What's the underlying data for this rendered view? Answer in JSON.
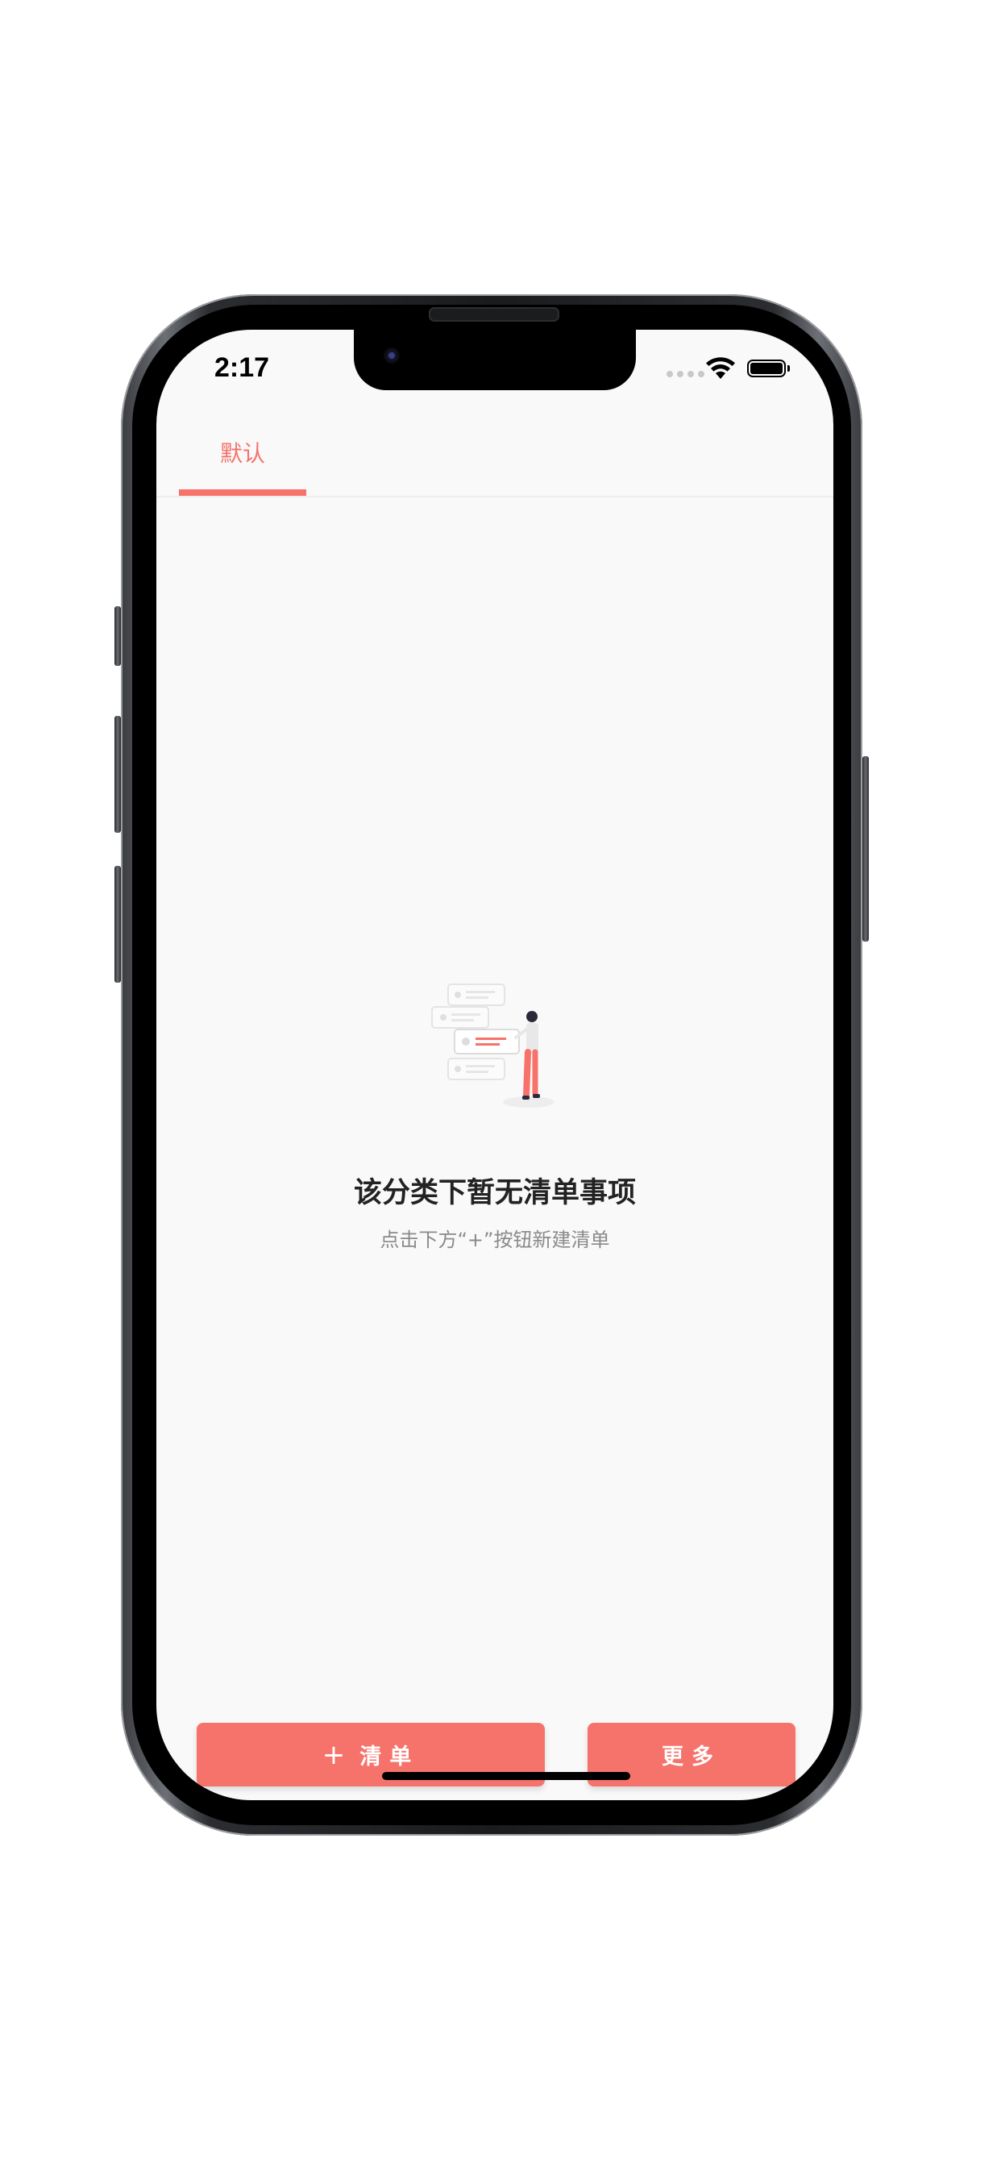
{
  "status_bar": {
    "time": "2:17",
    "wifi_icon": "wifi-icon",
    "battery_icon": "battery-icon",
    "signal_icon": "signal-dots-icon"
  },
  "tabs": [
    {
      "label": "默认",
      "active": true
    }
  ],
  "empty_state": {
    "illustration": "empty-list-illustration",
    "title": "该分类下暂无清单事项",
    "subtitle": "点击下方“+”按钮新建清单"
  },
  "buttons": {
    "add_icon": "+",
    "add_label": "清单",
    "more_label": "更多"
  },
  "colors": {
    "accent": "#f6726a",
    "background": "#f9f9f9",
    "title_text": "#222222",
    "subtitle_text": "#8a8a8a"
  }
}
